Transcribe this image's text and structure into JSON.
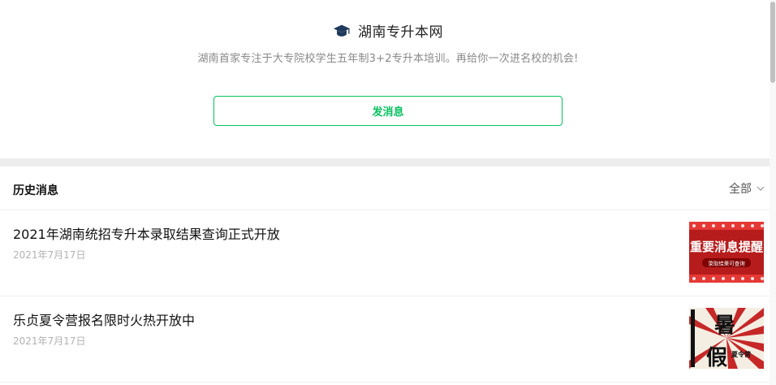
{
  "account": {
    "name": "湖南专升本网",
    "description": "湖南首家专注于大专院校学生五年制3+2专升本培训。再给你一次进名校的机会!",
    "logo_icon": "graduation-cap-icon",
    "accent_color": "#07c160"
  },
  "actions": {
    "send_message_label": "发消息"
  },
  "history": {
    "title": "历史消息",
    "filter_label": "全部",
    "filter_icon": "chevron-down-icon",
    "items": [
      {
        "title": "2021年湖南统招专升本录取结果查询正式开放",
        "date": "2021年7月17日",
        "thumb_text": "重要消息提醒",
        "thumb_subtext": "录取结果可查询"
      },
      {
        "title": "乐贞夏令营报名限时火热开放中",
        "date": "2021年7月17日",
        "thumb_text_1": "暑",
        "thumb_text_2": "假",
        "thumb_subtext": "夏令营"
      }
    ]
  }
}
